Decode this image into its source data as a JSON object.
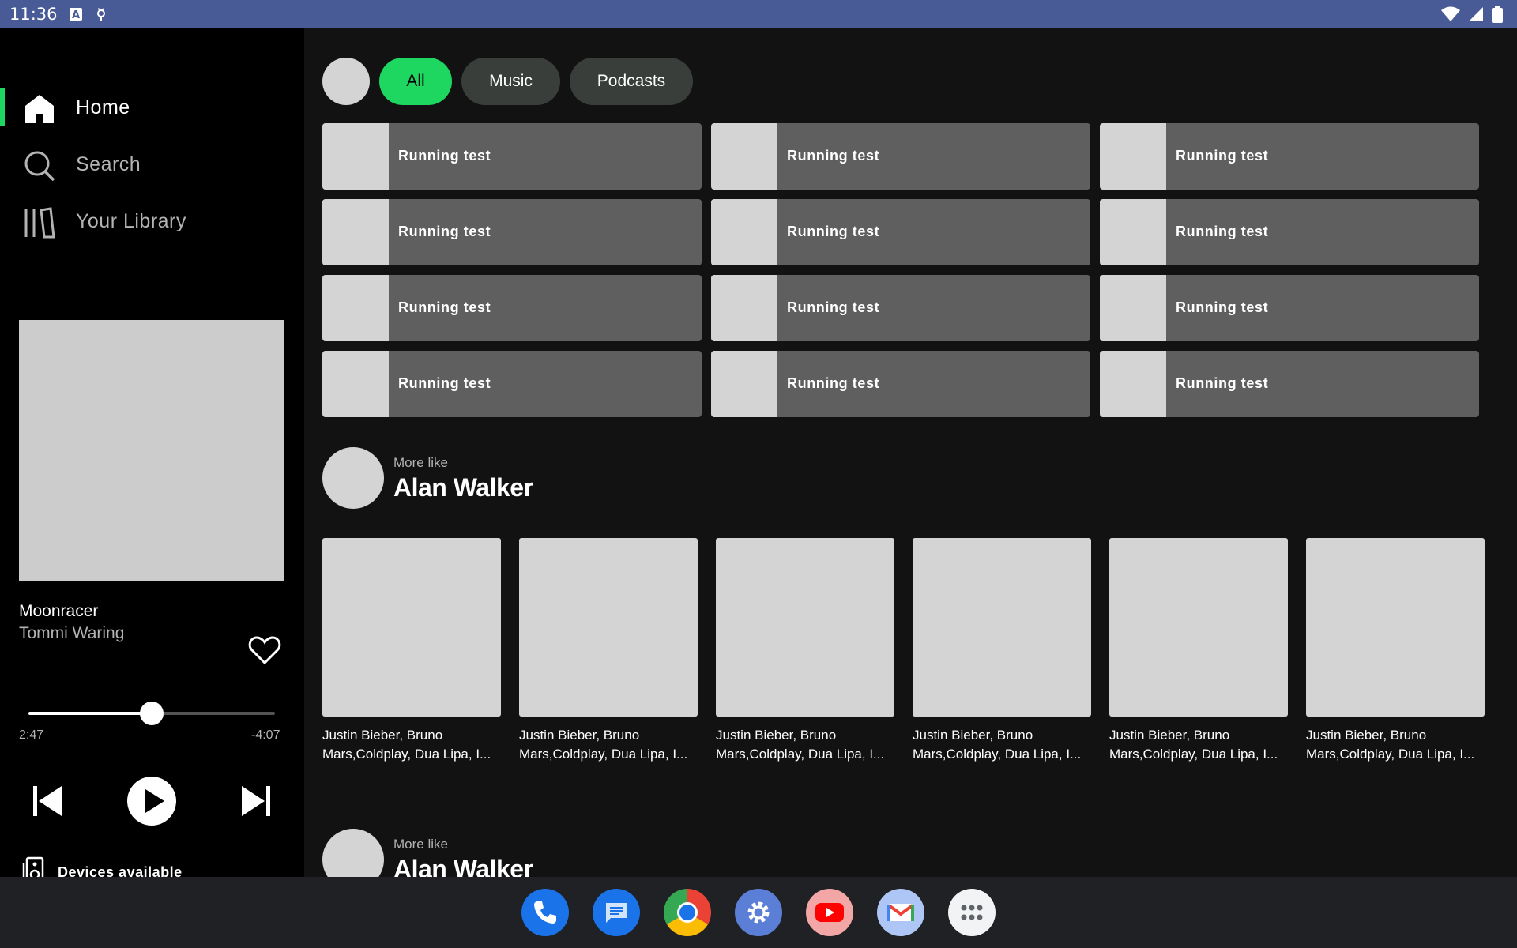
{
  "status_bar": {
    "time": "11:36",
    "icons": [
      "keyboard-a-icon",
      "usb-debug-icon",
      "wifi-icon",
      "signal-icon",
      "battery-icon"
    ]
  },
  "sidebar": {
    "nav": [
      {
        "label": "Home",
        "icon": "home-icon",
        "active": true
      },
      {
        "label": "Search",
        "icon": "search-icon",
        "active": false
      },
      {
        "label": "Your Library",
        "icon": "library-icon",
        "active": false
      }
    ],
    "accent_color": "#1ed760"
  },
  "player": {
    "title": "Moonracer",
    "artist": "Tommi Waring",
    "elapsed": "2:47",
    "remaining": "-4:07",
    "progress_fraction": 0.5,
    "devices_label": "Devices available"
  },
  "filters": {
    "chips": [
      {
        "label": "All",
        "active": true
      },
      {
        "label": "Music",
        "active": false
      },
      {
        "label": "Podcasts",
        "active": false
      }
    ]
  },
  "shortcuts": [
    "Running test",
    "Running test",
    "Running test",
    "Running test",
    "Running test",
    "Running test",
    "Running test",
    "Running test",
    "Running test",
    "Running test",
    "Running test",
    "Running test"
  ],
  "sections": [
    {
      "kicker": "More like",
      "title": "Alan Walker",
      "cards": [
        "Justin Bieber, Bruno\nMars,Coldplay, Dua Lipa, I...",
        "Justin Bieber, Bruno\nMars,Coldplay, Dua Lipa, I...",
        "Justin Bieber, Bruno\nMars,Coldplay, Dua Lipa, I...",
        "Justin Bieber, Bruno\nMars,Coldplay, Dua Lipa, I...",
        "Justin Bieber, Bruno\nMars,Coldplay, Dua Lipa, I...",
        "Justin Bieber, Bruno\nMars,Coldplay, Dua Lipa, I..."
      ]
    },
    {
      "kicker": "More like",
      "title": "Alan Walker"
    }
  ],
  "dock": {
    "apps": [
      "phone-icon",
      "messages-icon",
      "chrome-icon",
      "settings-icon",
      "youtube-icon",
      "gmail-icon",
      "app-drawer-icon"
    ]
  }
}
